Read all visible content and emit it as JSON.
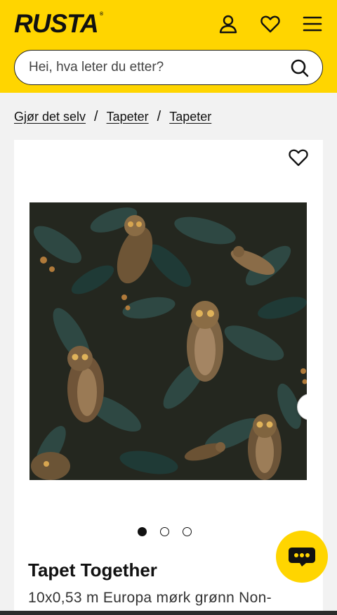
{
  "brand": {
    "logo_text": "RUSTA",
    "registered_mark": "®"
  },
  "header": {
    "account_icon": "user-icon",
    "favorites_icon": "heart-icon",
    "menu_icon": "hamburger-menu-icon",
    "background_color": "#ffd500"
  },
  "search": {
    "placeholder": "Hei, hva leter du etter?",
    "value": "",
    "icon": "search-icon"
  },
  "breadcrumb": {
    "items": [
      {
        "label": "Gjør det selv"
      },
      {
        "label": "Tapeter"
      },
      {
        "label": "Tapeter"
      }
    ],
    "separator": "/"
  },
  "product": {
    "title": "Tapet Together",
    "subtitle": "10x0,53 m Europa mørk grønn Non-",
    "image_description_icon": "owl-wallpaper-image",
    "gallery": {
      "total_images": 3,
      "active_index": 0
    },
    "next_icon": "chevron-right-icon",
    "favorite_icon": "heart-outline-icon"
  },
  "chat": {
    "icon": "chat-bubble-icon"
  }
}
